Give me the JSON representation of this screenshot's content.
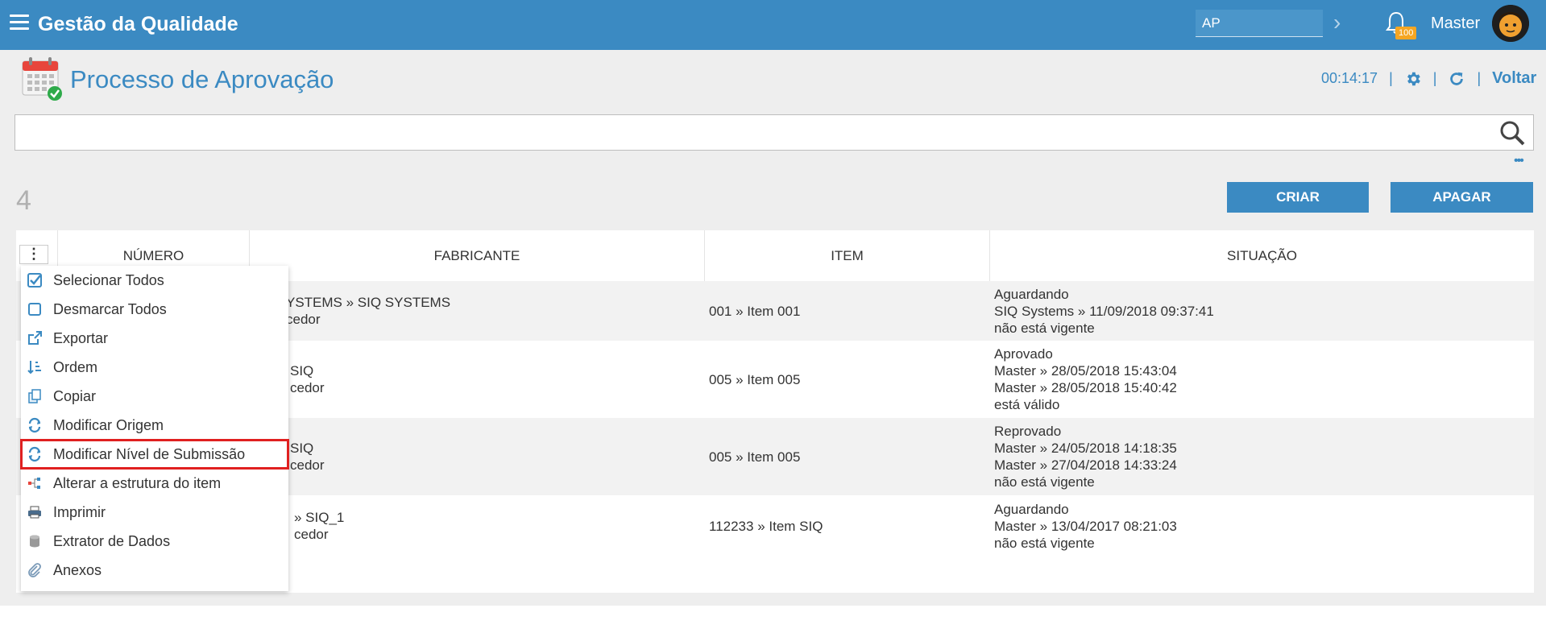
{
  "app": {
    "title": "Gestão da Qualidade"
  },
  "topbar": {
    "search_value": "AP",
    "notification_count": "100",
    "user_name": "Master"
  },
  "header": {
    "title": "Processo de Aprovação",
    "time": "00:14:17",
    "separator": "|",
    "back_label": "Voltar"
  },
  "list": {
    "count": "4",
    "create_label": "CRIAR",
    "delete_label": "APAGAR",
    "columns": [
      "NÚMERO",
      "FABRICANTE",
      "ITEM",
      "SITUAÇÃO"
    ],
    "rows": [
      {
        "fabricante": [
          "YSTEMS » SIQ SYSTEMS",
          "cedor"
        ],
        "item": "001 » Item 001",
        "situacao": [
          "Aguardando",
          "SIQ Systems » 11/09/2018 09:37:41",
          "não está vigente"
        ]
      },
      {
        "fabricante": [
          "SIQ",
          "cedor"
        ],
        "item": "005 » Item 005",
        "situacao": [
          "Aprovado",
          "Master » 28/05/2018 15:43:04",
          "Master » 28/05/2018 15:40:42",
          "está válido"
        ]
      },
      {
        "fabricante": [
          "SIQ",
          "cedor"
        ],
        "item": "005 » Item 005",
        "situacao": [
          "Reprovado",
          "Master » 24/05/2018 14:18:35",
          "Master » 27/04/2018 14:33:24",
          "não está vigente"
        ]
      },
      {
        "fabricante": [
          "» SIQ_1",
          "cedor"
        ],
        "item": "112233 » Item SIQ",
        "situacao": [
          "Aguardando",
          "Master » 13/04/2017 08:21:03",
          "não está vigente"
        ]
      }
    ]
  },
  "menu": {
    "items": [
      {
        "label": "Selecionar Todos",
        "icon": "checkbox-checked-icon"
      },
      {
        "label": "Desmarcar Todos",
        "icon": "checkbox-empty-icon"
      },
      {
        "label": "Exportar",
        "icon": "export-icon"
      },
      {
        "label": "Ordem",
        "icon": "sort-icon"
      },
      {
        "label": "Copiar",
        "icon": "copy-icon"
      },
      {
        "label": "Modificar Origem",
        "icon": "refresh-icon"
      },
      {
        "label": "Modificar Nível de Submissão",
        "icon": "refresh-icon",
        "highlighted": true
      },
      {
        "label": "Alterar a estrutura do item",
        "icon": "structure-icon"
      },
      {
        "label": "Imprimir",
        "icon": "printer-icon"
      },
      {
        "label": "Extrator de Dados",
        "icon": "database-icon"
      },
      {
        "label": "Anexos",
        "icon": "paperclip-icon"
      }
    ]
  },
  "colors": {
    "primary": "#3b8ac2",
    "badge": "#f5a623",
    "highlight_border": "#e02020",
    "band": "#eeeeee"
  }
}
